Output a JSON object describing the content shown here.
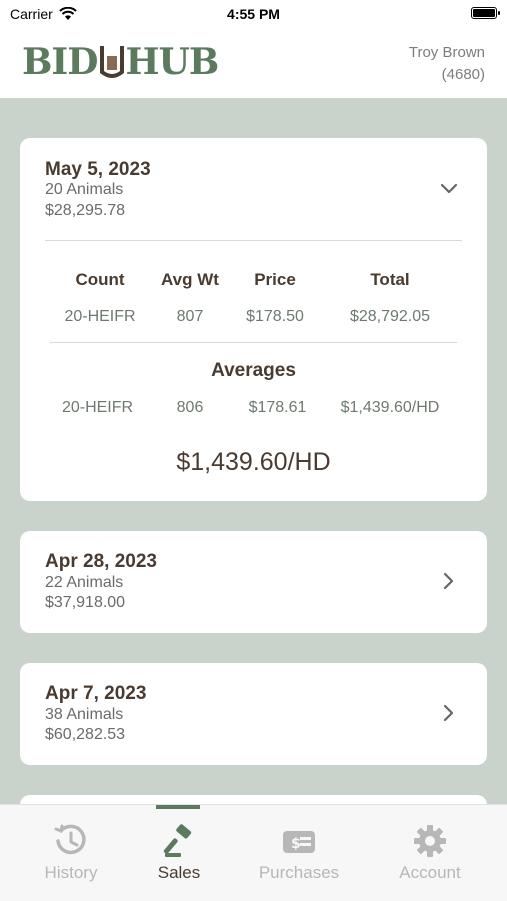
{
  "status_bar": {
    "carrier": "Carrier",
    "time": "4:55 PM"
  },
  "header": {
    "logo": {
      "left": "BID",
      "right": "HUB"
    },
    "user_name": "Troy Brown",
    "user_id": "(4680)"
  },
  "sales": [
    {
      "date": "May 5, 2023",
      "animals": "20 Animals",
      "amount": "$28,295.78",
      "expanded": true,
      "columns": [
        "Count",
        "Avg Wt",
        "Price",
        "Total"
      ],
      "rows": [
        [
          "20-HEIFR",
          "807",
          "$178.50",
          "$28,792.05"
        ]
      ],
      "averages_title": "Averages",
      "averages": [
        "20-HEIFR",
        "806",
        "$178.61",
        "$1,439.60/HD"
      ],
      "total_per_head": "$1,439.60/HD"
    },
    {
      "date": "Apr 28, 2023",
      "animals": "22 Animals",
      "amount": "$37,918.00",
      "expanded": false
    },
    {
      "date": "Apr 7, 2023",
      "animals": "38 Animals",
      "amount": "$60,282.53",
      "expanded": false
    }
  ],
  "tabs": [
    {
      "label": "History",
      "icon": "history-icon",
      "active": false
    },
    {
      "label": "Sales",
      "icon": "gavel-icon",
      "active": true
    },
    {
      "label": "Purchases",
      "icon": "bill-icon",
      "active": false
    },
    {
      "label": "Account",
      "icon": "gear-icon",
      "active": false
    }
  ],
  "colors": {
    "brand_green": "#5b7a5e",
    "background": "#c9d3cb",
    "heading_brown": "#4a3b30",
    "inactive_tab": "#b7b7b7"
  }
}
